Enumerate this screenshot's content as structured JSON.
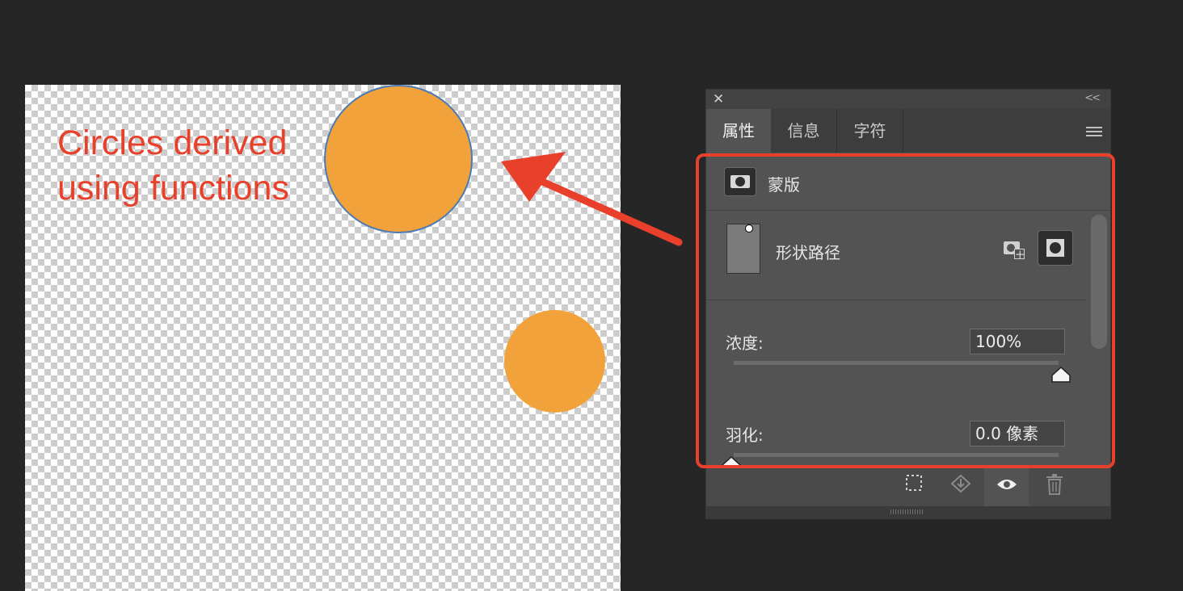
{
  "canvas": {
    "annotation_line1": "Circles derived",
    "annotation_line2": "using functions",
    "circle_color": "#f2a23b",
    "annotation_color": "#e8402a"
  },
  "panel": {
    "close_icon": "close-icon",
    "collapse_icon": "double-chevron-left-icon",
    "tabs": [
      {
        "label": "属性",
        "active": true
      },
      {
        "label": "信息",
        "active": false
      },
      {
        "label": "字符",
        "active": false
      }
    ],
    "menu_icon": "hamburger-menu-icon",
    "mask": {
      "label": "蒙版",
      "icon": "mask-icon"
    },
    "path": {
      "label": "形状路径",
      "icon": "vector-mask-thumbnail"
    },
    "density": {
      "label": "浓度:",
      "value": "100%",
      "level": 1.0
    },
    "feather": {
      "label": "羽化:",
      "value": "0.0 像素",
      "level": 0.0
    },
    "bottom_icons": [
      "load-selection-icon",
      "apply-mask-icon",
      "eye-icon",
      "trash-icon"
    ],
    "highlight_color": "#e8402a"
  }
}
